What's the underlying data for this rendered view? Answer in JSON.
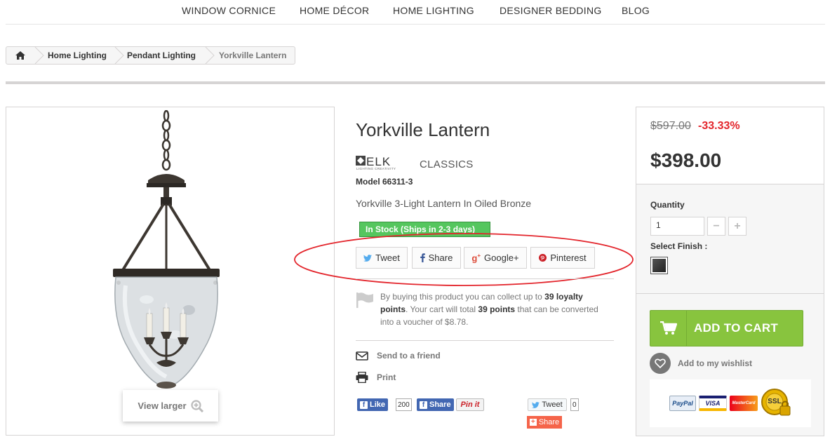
{
  "topnav": {
    "items": [
      "WINDOW CORNICE",
      "HOME DÉCOR",
      "HOME LIGHTING",
      "DESIGNER BEDDING",
      "BLOG"
    ]
  },
  "breadcrumb": {
    "home_icon": "home-icon",
    "items": [
      "Home Lighting",
      "Pendant Lighting"
    ],
    "current": "Yorkville Lantern"
  },
  "image": {
    "view_larger": "View larger",
    "zoom_icon": "zoom-in-icon"
  },
  "product": {
    "title": "Yorkville Lantern",
    "brand_logo_text": "ELK",
    "brand_logo_tagline": "LIGHTING CREATIVITY",
    "brand": "CLASSICS",
    "model": "Model 66311-3",
    "short_description": "Yorkville 3-Light Lantern In Oiled Bronze",
    "stock": "In Stock (Ships in 2-3 days)",
    "stock_color": "#55c65e"
  },
  "social": {
    "tweet": "Tweet",
    "share": "Share",
    "google": "Google+",
    "pinterest": "Pinterest",
    "highlight_color": "#e3242b"
  },
  "loyalty": {
    "pre": "By buying this product you can collect up to ",
    "points1": "39 loyalty points",
    "mid": ". Your cart will total ",
    "points2": "39 points",
    "post": " that can be converted into a voucher of $8.78."
  },
  "actions": {
    "send_friend": "Send to a friend",
    "print": "Print"
  },
  "widgets": {
    "fb_like": "Like",
    "fb_like_count": "200",
    "fb_share": "Share",
    "pin_it": "Pin it",
    "tweet": "Tweet",
    "tweet_count": "0",
    "share": "Share"
  },
  "pricing": {
    "old_price": "$597.00",
    "discount": "-33.33%",
    "price": "$398.00",
    "quantity_label": "Quantity",
    "quantity_value": "1",
    "finish_label": "Select Finish :",
    "add_to_cart": "ADD TO CART",
    "cart_color": "#88c43e",
    "wishlist": "Add to my wishlist",
    "payment_cards": [
      "PayPal",
      "VISA",
      "MasterCard",
      "SSL"
    ]
  }
}
